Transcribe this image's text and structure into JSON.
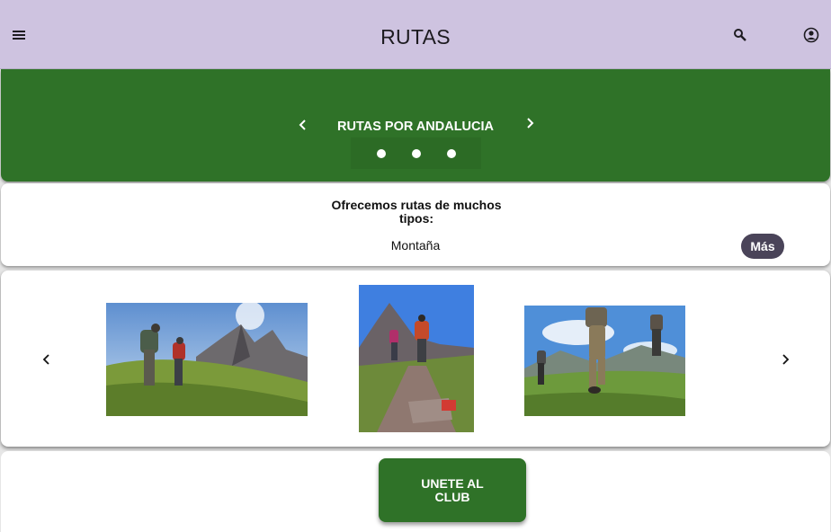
{
  "appbar": {
    "title": "RUTAS",
    "icons": [
      "menu-icon",
      "search-icon",
      "account-icon"
    ]
  },
  "banner": {
    "title": "RUTAS POR ANDALUCIA",
    "dots": 3,
    "color": "#2f7228"
  },
  "info": {
    "lead": "Ofrecemos rutas de muchos tipos:",
    "kind": "Montaña",
    "more_label": "Más"
  },
  "gallery": {
    "photos": [
      "hikers-rocky-peaks-photo",
      "hikers-trail-photo",
      "hikers-meadow-photo"
    ]
  },
  "cta": {
    "label": "UNETE AL CLUB"
  },
  "colors": {
    "appbar": "#cec3e0",
    "primary": "#2f7228",
    "chip": "#4a4459"
  }
}
